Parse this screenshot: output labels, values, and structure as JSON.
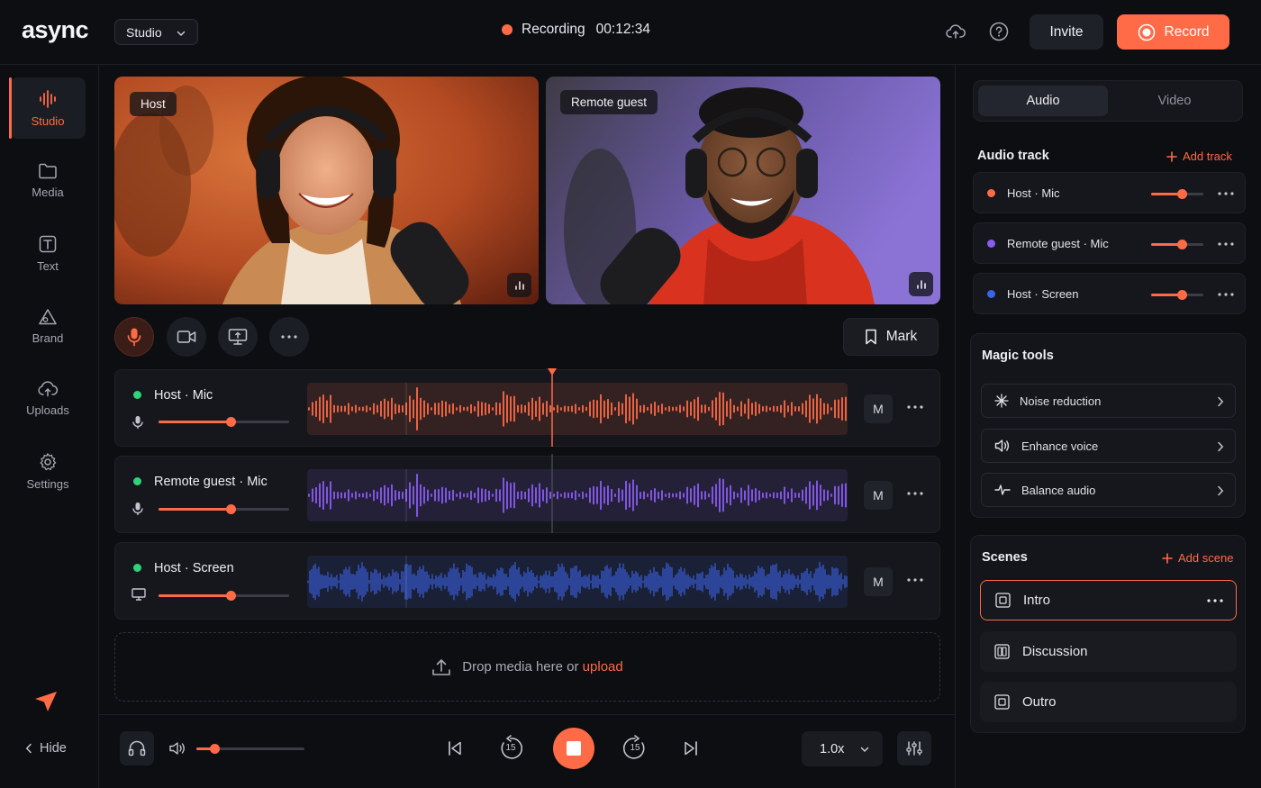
{
  "app": {
    "logo": "async",
    "workspace_select": "Studio",
    "recording_label": "Recording",
    "recording_time": "00:12:34",
    "invite_label": "Invite",
    "record_label": "Record",
    "accent": "#ff6a47"
  },
  "sidebar": {
    "items": [
      {
        "label": "Studio",
        "icon": "waveform-icon",
        "active": true
      },
      {
        "label": "Media",
        "icon": "folder-icon"
      },
      {
        "label": "Text",
        "icon": "text-icon"
      },
      {
        "label": "Brand",
        "icon": "brand-icon"
      },
      {
        "label": "Uploads",
        "icon": "cloud-upload-icon"
      },
      {
        "label": "Settings",
        "icon": "gear-icon"
      }
    ],
    "hide_label": "Hide"
  },
  "stage": {
    "host_tag": "Host",
    "guest_tag": "Remote guest",
    "mark_label": "Mark"
  },
  "tracks": [
    {
      "source": "Host",
      "type": "Mic",
      "color": "#ff6a47",
      "level": 0.55
    },
    {
      "source": "Remote guest",
      "type": "Mic",
      "color": "#8a5cf6",
      "level": 0.55
    },
    {
      "source": "Host",
      "type": "Screen",
      "color": "#3b63e8",
      "level": 0.55
    }
  ],
  "dropzone": {
    "text": "Drop media here or ",
    "link": "upload"
  },
  "transport": {
    "volume": 0.17,
    "skip_back": "15",
    "skip_forward": "15",
    "speed": "1.0x"
  },
  "panel": {
    "tabs": [
      "Audio",
      "Video"
    ],
    "audio_track_title": "Audio track",
    "add_track": "Add track",
    "audio_tracks": [
      {
        "source": "Host",
        "type": "Mic",
        "color": "#ff6a47",
        "level": 0.58
      },
      {
        "source": "Remote guest",
        "type": "Mic",
        "color": "#8a5cf6",
        "level": 0.58
      },
      {
        "source": "Host",
        "type": "Screen",
        "color": "#3b63e8",
        "level": 0.58
      }
    ],
    "magic_title": "Magic tools",
    "magic_tools": [
      "Noise reduction",
      "Enhance voice",
      "Balance audio"
    ],
    "scenes_title": "Scenes",
    "add_scene": "Add scene",
    "scenes": [
      "Intro",
      "Discussion",
      "Outro"
    ],
    "separator": "·"
  }
}
